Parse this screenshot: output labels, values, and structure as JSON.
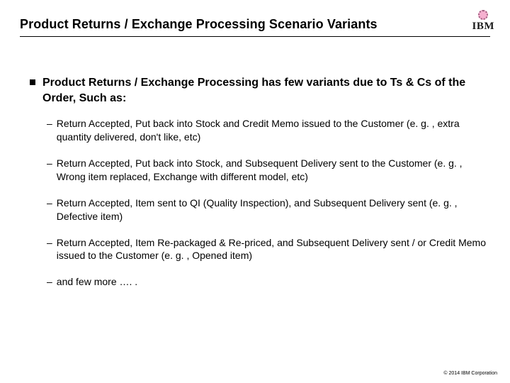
{
  "header": {
    "title": "Product Returns / Exchange Processing Scenario Variants",
    "logo_text": "IBM"
  },
  "body": {
    "lead": "Product Returns / Exchange Processing has few variants due to Ts & Cs of the Order, Such as:",
    "items": [
      "Return Accepted, Put back into Stock and Credit Memo issued to the Customer (e. g. , extra quantity delivered, don't like, etc)",
      "Return Accepted, Put back into Stock, and Subsequent Delivery sent to the Customer (e. g. , Wrong item replaced, Exchange with different model, etc)",
      "Return Accepted, Item sent to QI (Quality Inspection), and Subsequent Delivery sent (e. g. , Defective item)",
      "Return Accepted, Item Re-packaged & Re-priced, and Subsequent Delivery sent / or Credit Memo issued to the Customer (e. g. , Opened item)",
      "and few more …. ."
    ]
  },
  "footer": {
    "copyright": "© 2014 IBM Corporation"
  }
}
